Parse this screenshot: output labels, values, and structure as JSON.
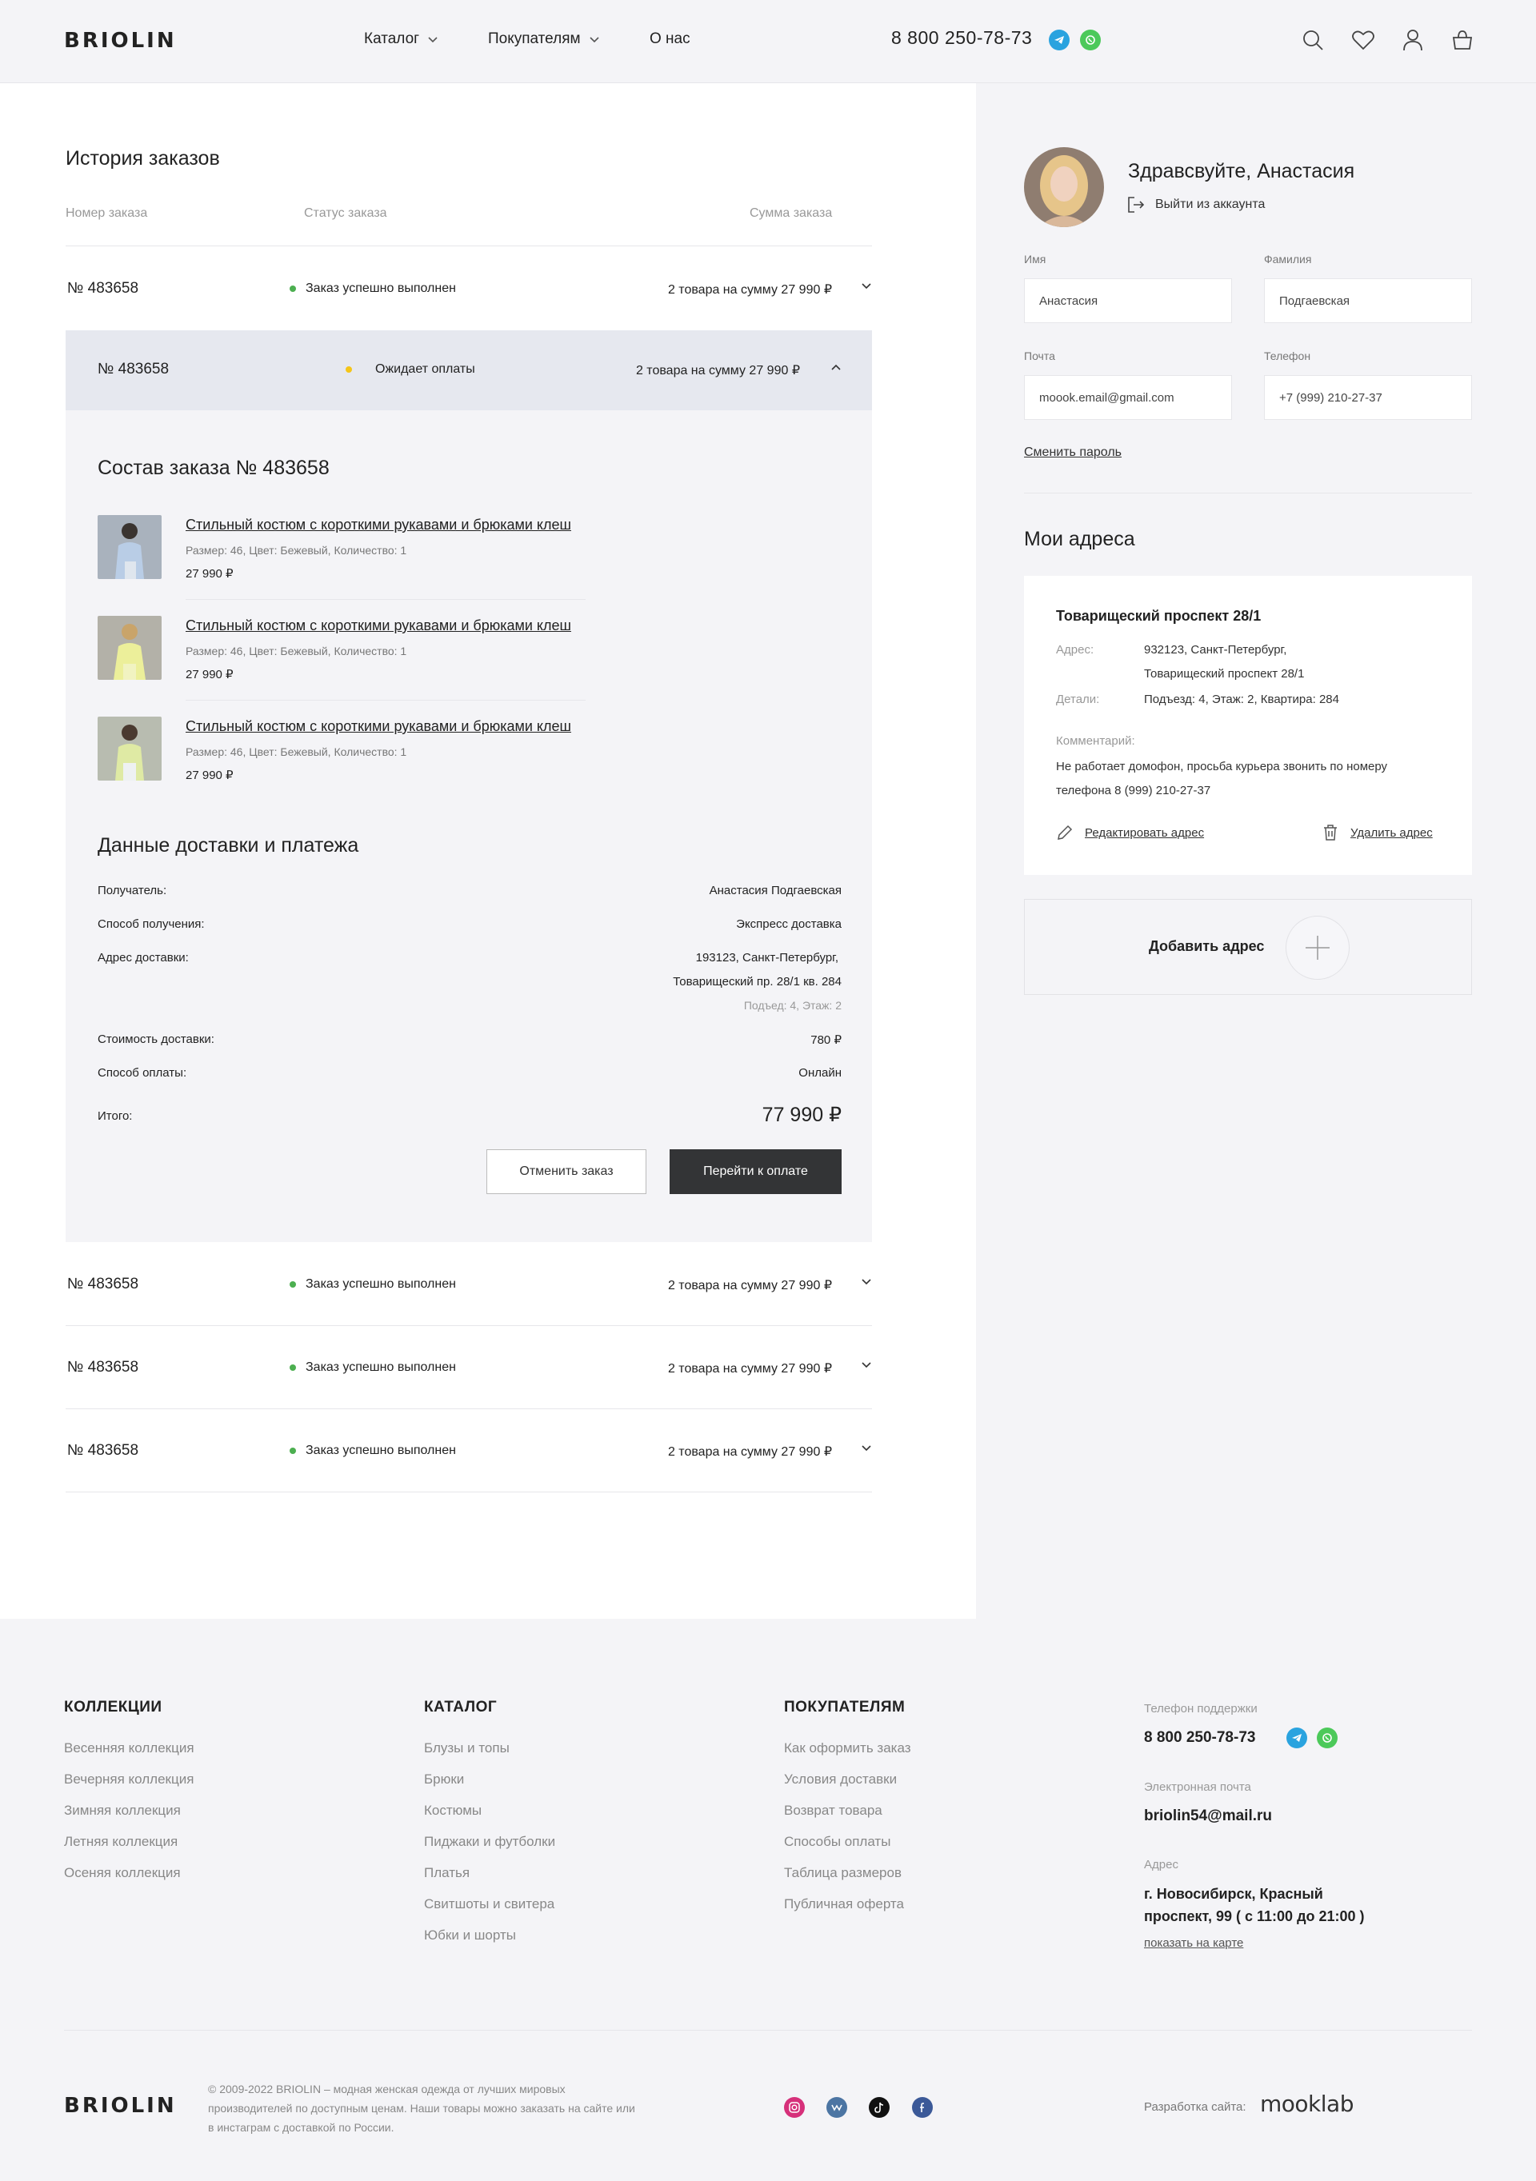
{
  "header": {
    "logo": "BRIOLIN",
    "nav": [
      "Каталог",
      "Покупателям",
      "О нас"
    ],
    "phone": "8 800 250-78-73"
  },
  "orders": {
    "title": "История заказов",
    "columns": [
      "Номер заказа",
      "Статус заказа",
      "Сумма заказа"
    ],
    "rows": [
      {
        "num": "№ 483658",
        "status": "Заказ успешно выполнен",
        "sum": "2 товара на сумму 27 990 ₽"
      },
      {
        "num": "№ 483658",
        "status": "Ожидает оплаты",
        "sum": "2 товара на сумму 27 990 ₽"
      },
      {
        "num": "№ 483658",
        "status": "Заказ успешно выполнен",
        "sum": "2 товара на сумму 27 990 ₽"
      },
      {
        "num": "№ 483658",
        "status": "Заказ успешно выполнен",
        "sum": "2 товара на сумму 27 990 ₽"
      },
      {
        "num": "№ 483658",
        "status": "Заказ успешно выполнен",
        "sum": "2 товара на сумму 27 990 ₽"
      }
    ],
    "status_colors": {
      "done": "#4caf50",
      "pending": "#f5c518"
    }
  },
  "composition": {
    "title": "Состав заказа № 483658",
    "products": [
      {
        "name": "Стильный костюм с короткими рукавами и брюками клеш",
        "meta": "Размер: 46,  Цвет: Бежевый,  Количество: 1",
        "price": "27 990 ₽"
      },
      {
        "name": "Стильный костюм с короткими рукавами и брюками клеш",
        "meta": "Размер: 46,  Цвет: Бежевый,  Количество: 1",
        "price": "27 990 ₽"
      },
      {
        "name": "Стильный костюм с короткими рукавами и брюками клеш",
        "meta": "Размер: 46,  Цвет: Бежевый,  Количество: 1",
        "price": "27 990 ₽"
      }
    ]
  },
  "delivery": {
    "title": "Данные доставки и платежа",
    "recipient_label": "Получатель:",
    "recipient": "Анастасия Подгаевская",
    "method_label": "Способ получения:",
    "method": "Экспресс доставка",
    "address_label": "Адрес доставки:",
    "address_line1": "193123, Санкт-Петербург,",
    "address_line2": "Товарищеский пр. 28/1 кв. 284",
    "address_line3": "Подъед: 4,  Этаж: 2",
    "cost_label": "Стоимость доставки:",
    "cost": "780 ₽",
    "payment_label": "Способ оплаты:",
    "payment": "Онлайн",
    "total_label": "Итого:",
    "total": "77 990 ₽",
    "cancel_button": "Отменить заказ",
    "pay_button": "Перейти к оплате"
  },
  "profile": {
    "greeting": "Здравсвуйте, Анастасия",
    "logout": "Выйти из аккаунта",
    "first_name_label": "Имя",
    "first_name": "Анастасия",
    "last_name_label": "Фамилия",
    "last_name": "Подгаевская",
    "email_label": "Почта",
    "email": "moook.email@gmail.com",
    "phone_label": "Телефон",
    "phone": "+7 (999) 210-27-37",
    "change_password": "Сменить пароль"
  },
  "addresses": {
    "title": "Мои адреса",
    "card_title": "Товарищеский проспект 28/1",
    "address_label": "Адрес:",
    "address_line1": "932123, Санкт-Петербург,",
    "address_line2": "Товарищеский проспект 28/1",
    "details_label": "Детали:",
    "details": "Подъезд: 4, Этаж: 2, Квартира: 284",
    "comment_label": "Комментарий:",
    "comment_line1": "Не работает домофон, просьба курьера звонить по номеру",
    "comment_line2": "телефона 8 (999) 210-27-37",
    "edit": "Редактировать адрес",
    "delete": "Удалить адрес",
    "add": "Добавить адрес"
  },
  "footer": {
    "col1_title": "КОЛЛЕКЦИИ",
    "col1": [
      "Весенняя коллекция",
      "Вечерняя коллекция",
      "Зимняя коллекция",
      "Летняя коллекция",
      "Осеняя коллекция"
    ],
    "col2_title": "КАТАЛОГ",
    "col2": [
      "Блузы и топы",
      "Брюки",
      "Костюмы",
      "Пиджаки и футболки",
      "Платья",
      "Свитшоты и свитера",
      "Юбки и шорты"
    ],
    "col3_title": "ПОКУПАТЕЛЯМ",
    "col3": [
      "Как оформить заказ",
      "Условия доставки",
      "Возврат товара",
      "Способы оплаты",
      "Таблица размеров",
      "Публичная оферта"
    ],
    "support_label": "Телефон поддержки",
    "support_phone": "8 800 250-78-73",
    "email_label": "Электронная почта",
    "email": "briolin54@mail.ru",
    "address_label": "Адрес",
    "address_line1": "г. Новосибирск, Красный",
    "address_line2": "проспект, 99 ( с 11:00 до 21:00 )",
    "map_link": "показать на карте",
    "logo": "BRIOLIN",
    "copyright_line1": "© 2009-2022 BRIOLIN – модная женская одежда от лучших мировых",
    "copyright_line2": "производителей по доступным ценам. Наши товары можно заказать на сайте или",
    "copyright_line3": "в инстаграм с доставкой по России.",
    "dev_label": "Разработка сайта:",
    "dev_brand": "mooklab"
  }
}
